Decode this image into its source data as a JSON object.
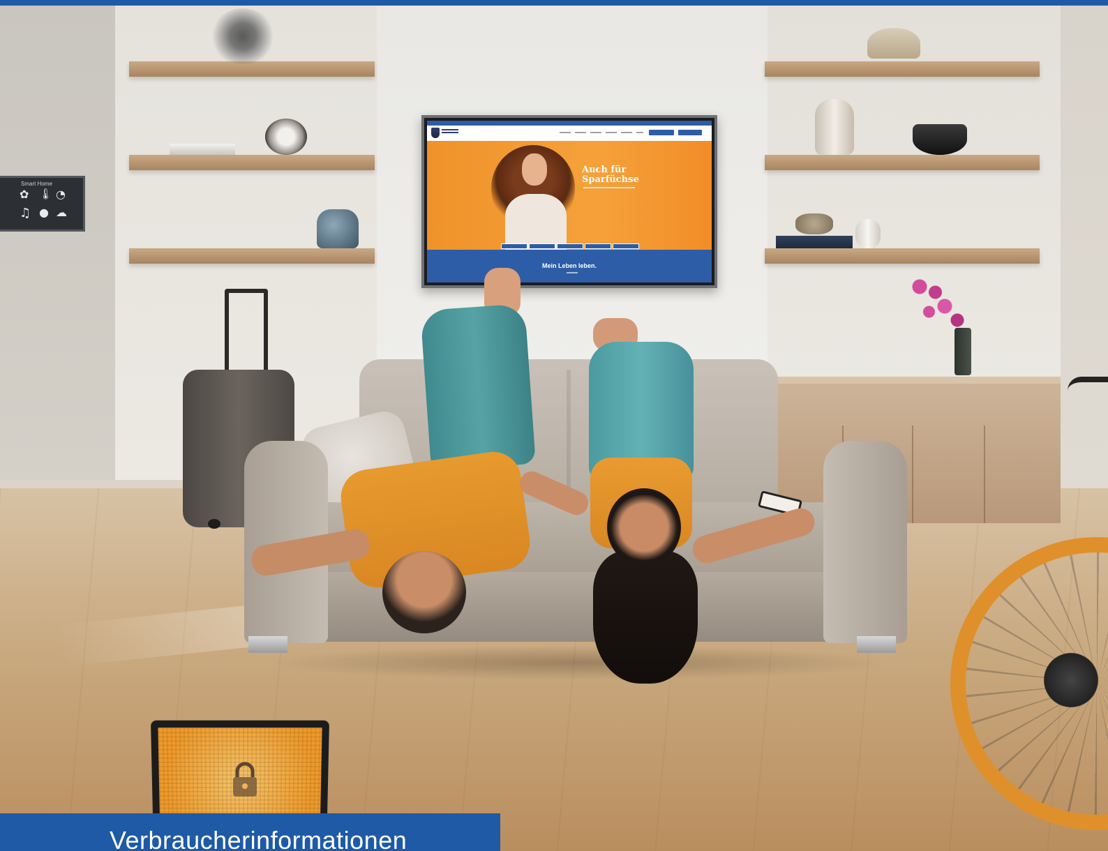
{
  "colors": {
    "brand_blue": "#1f5aa6",
    "accent_orange": "#f28d27"
  },
  "smart_home_panel": {
    "title": "Smart Home",
    "icons": [
      "flower-icon",
      "thermometer-icon",
      "gauge-icon",
      "music-note-icon",
      "light-bulb-icon",
      "cloud-icon"
    ]
  },
  "tv_website": {
    "headline_line1": "Auch für",
    "headline_line2": "Sparfüchse",
    "band_title": "Mein Leben leben."
  },
  "banner": {
    "label": "Verbraucherinformationen"
  }
}
